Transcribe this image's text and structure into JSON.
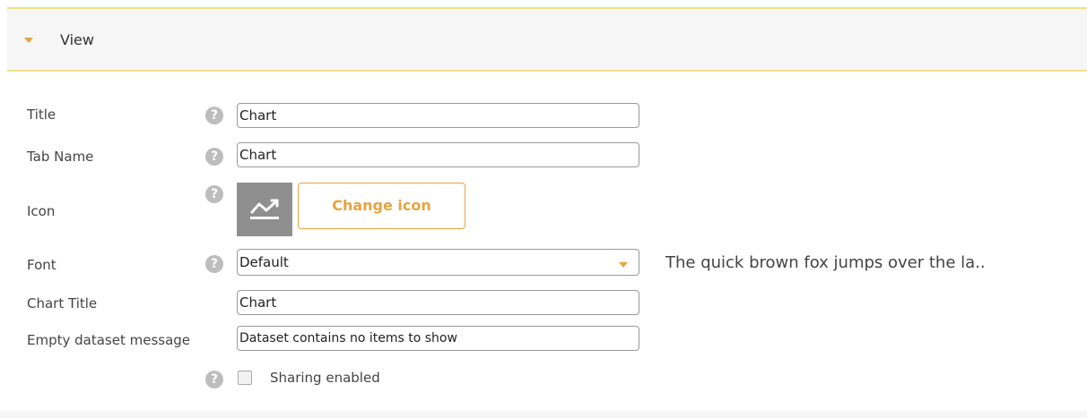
{
  "panel": {
    "title": "View"
  },
  "form": {
    "title_label": "Title",
    "title_value": "Chart",
    "tab_name_label": "Tab Name",
    "tab_name_value": "Chart",
    "icon_label": "Icon",
    "icon_name": "chart-line-icon",
    "change_icon_label": "Change icon",
    "font_label": "Font",
    "font_value": "Default",
    "font_preview": "The quick brown fox jumps over the la..",
    "chart_title_label": "Chart Title",
    "chart_title_value": "Chart",
    "empty_message_label": "Empty dataset message",
    "empty_message_value": "Dataset contains no items to show",
    "sharing_label": "Sharing enabled",
    "sharing_enabled": false
  },
  "help_glyph": "?",
  "colors": {
    "accent": "#e8a33c",
    "header_bg": "#f6f6f6",
    "header_border": "#f0e08a",
    "help_icon": "#bdbdbd",
    "icon_tile": "#8f8f8f"
  }
}
